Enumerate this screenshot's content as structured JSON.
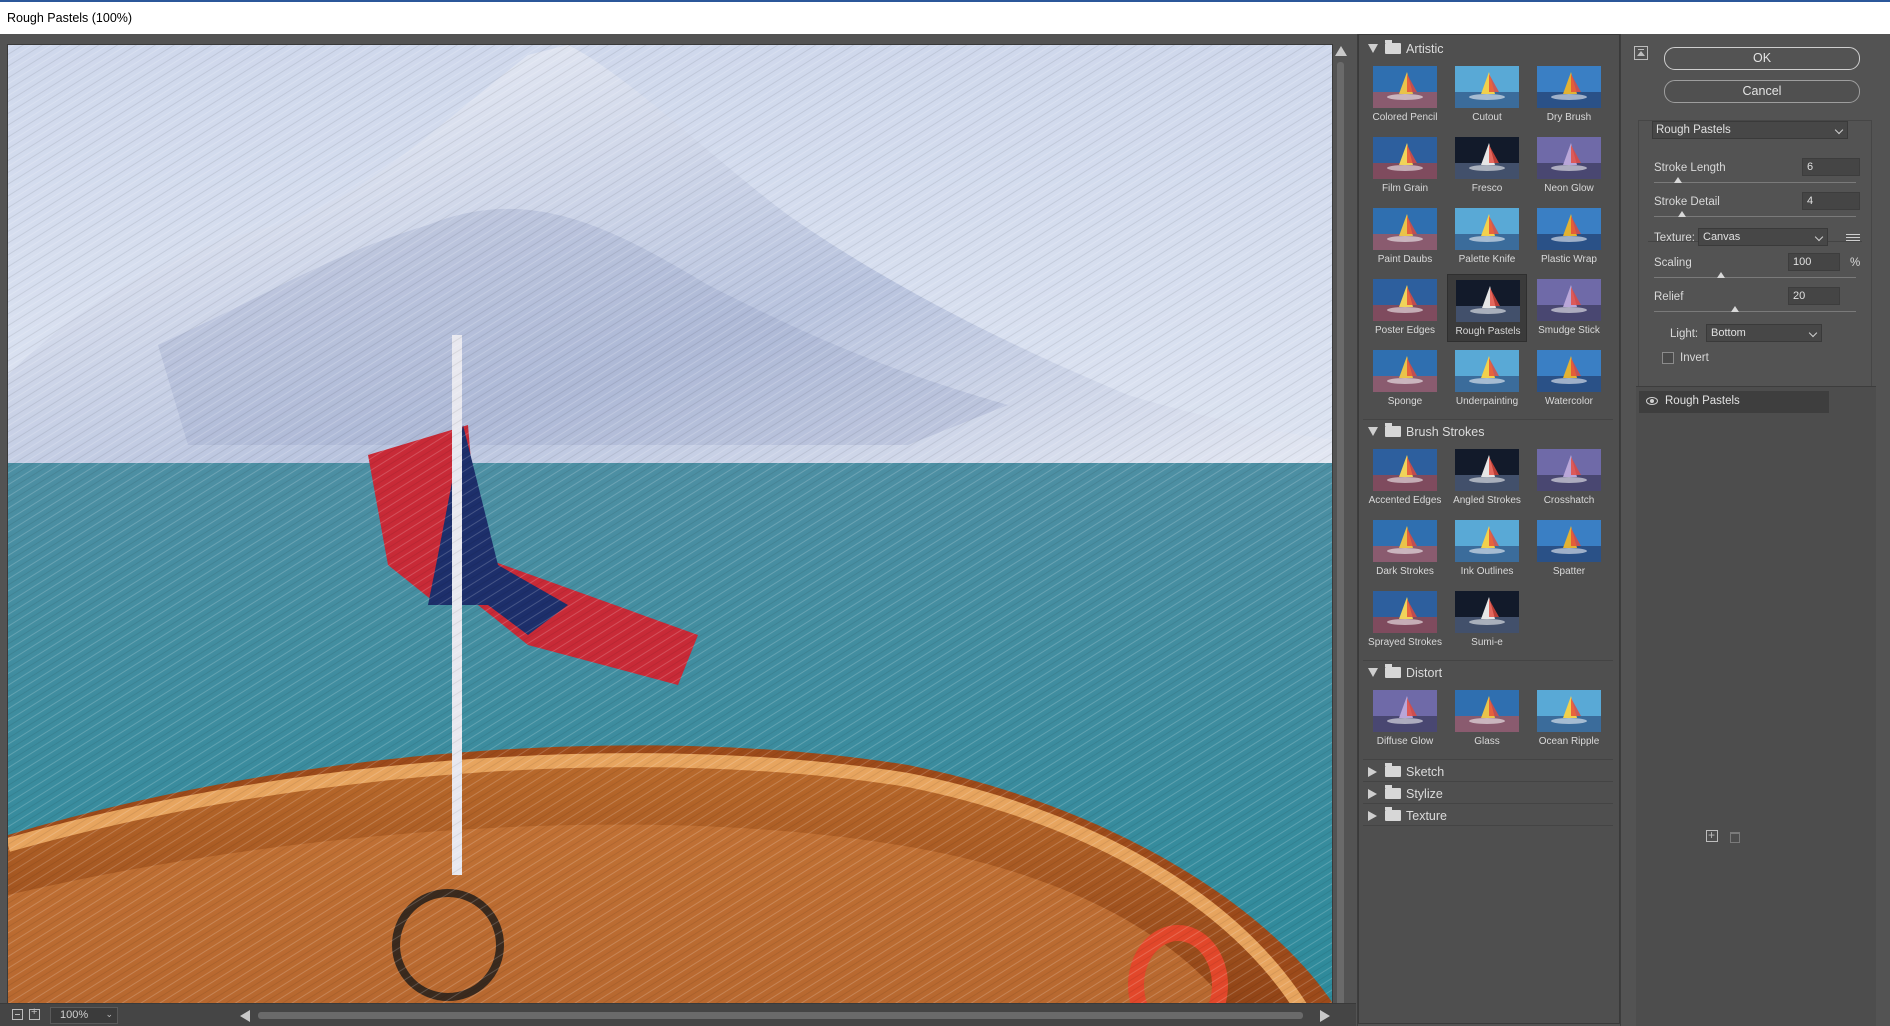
{
  "window": {
    "title": "Rough Pastels (100%)"
  },
  "preview": {
    "zoom": "100%"
  },
  "gallery": {
    "categories": [
      {
        "name": "Artistic",
        "expanded": true,
        "filters": [
          {
            "label": "Colored Pencil"
          },
          {
            "label": "Cutout"
          },
          {
            "label": "Dry Brush"
          },
          {
            "label": "Film Grain"
          },
          {
            "label": "Fresco"
          },
          {
            "label": "Neon Glow"
          },
          {
            "label": "Paint Daubs"
          },
          {
            "label": "Palette Knife"
          },
          {
            "label": "Plastic Wrap"
          },
          {
            "label": "Poster Edges"
          },
          {
            "label": "Rough Pastels",
            "selected": true
          },
          {
            "label": "Smudge Stick"
          },
          {
            "label": "Sponge"
          },
          {
            "label": "Underpainting"
          },
          {
            "label": "Watercolor"
          }
        ]
      },
      {
        "name": "Brush Strokes",
        "expanded": true,
        "filters": [
          {
            "label": "Accented Edges"
          },
          {
            "label": "Angled Strokes"
          },
          {
            "label": "Crosshatch"
          },
          {
            "label": "Dark Strokes"
          },
          {
            "label": "Ink Outlines"
          },
          {
            "label": "Spatter"
          },
          {
            "label": "Sprayed Strokes"
          },
          {
            "label": "Sumi-e"
          }
        ]
      },
      {
        "name": "Distort",
        "expanded": true,
        "filters": [
          {
            "label": "Diffuse Glow"
          },
          {
            "label": "Glass"
          },
          {
            "label": "Ocean Ripple"
          }
        ]
      },
      {
        "name": "Sketch",
        "expanded": false
      },
      {
        "name": "Stylize",
        "expanded": false
      },
      {
        "name": "Texture",
        "expanded": false
      }
    ]
  },
  "controls": {
    "ok_label": "OK",
    "cancel_label": "Cancel",
    "filter_select": "Rough Pastels",
    "stroke_length": {
      "label": "Stroke Length",
      "value": "6",
      "fraction": 0.12
    },
    "stroke_detail": {
      "label": "Stroke Detail",
      "value": "4",
      "fraction": 0.14
    },
    "texture": {
      "label": "Texture:",
      "value": "Canvas"
    },
    "scaling": {
      "label": "Scaling",
      "value": "100",
      "unit": "%",
      "fraction": 0.33
    },
    "relief": {
      "label": "Relief",
      "value": "20",
      "fraction": 0.4
    },
    "light": {
      "label": "Light:",
      "value": "Bottom"
    },
    "invert": {
      "label": "Invert",
      "checked": false
    }
  },
  "layers": [
    {
      "name": "Rough Pastels",
      "visible": true
    }
  ],
  "colors": {
    "panel_bg": "#535353",
    "sea": "#3a8c9c",
    "flag_red": "#c82a37",
    "flag_blue": "#1d2f6b",
    "deck_orange": "#c7712b"
  },
  "icons": {
    "collapse": "collapse-panel-icon",
    "eye": "eye-icon",
    "new_layer": "new-layer-icon",
    "delete_layer": "trash-icon",
    "folder": "folder-icon"
  }
}
